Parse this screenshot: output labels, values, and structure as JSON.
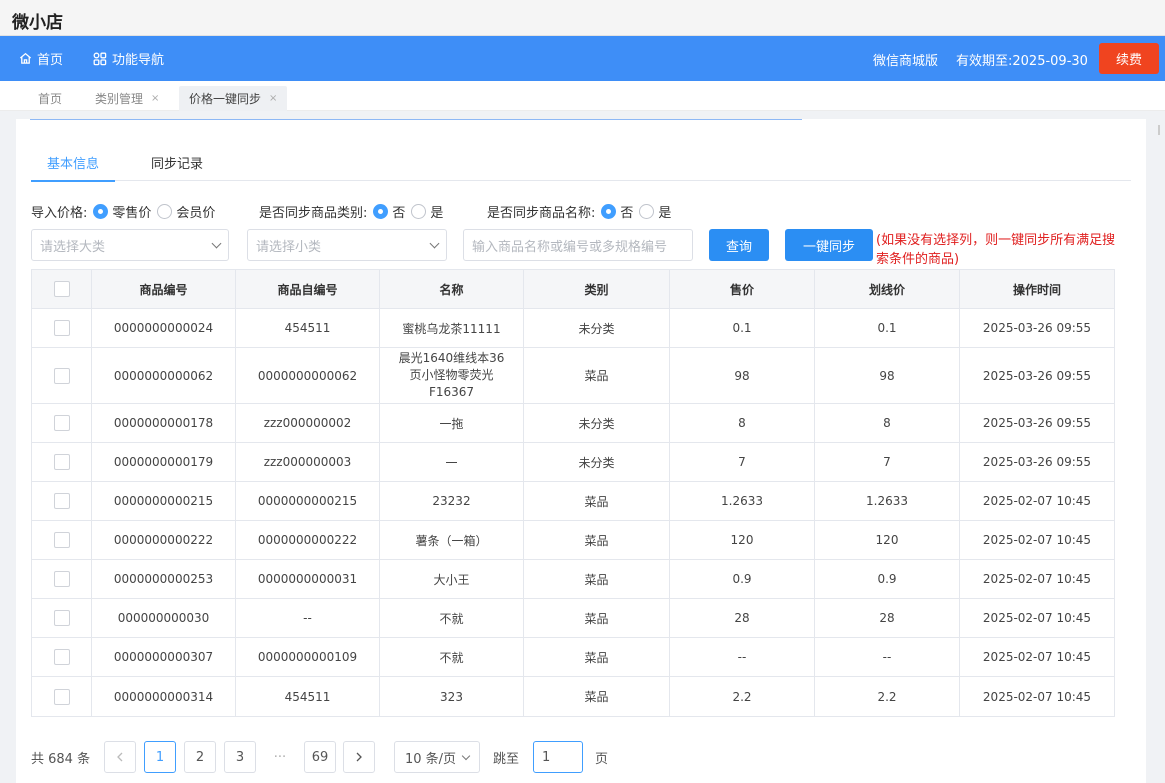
{
  "app": {
    "title": "微小店"
  },
  "nav": {
    "home": "首页",
    "functions": "功能导航",
    "edition": "微信商城版",
    "valid_until": "有效期至:2025-09-30",
    "renew": "续费"
  },
  "tabs": [
    {
      "label": "首页"
    },
    {
      "label": "类别管理"
    },
    {
      "label": "价格一键同步"
    }
  ],
  "subtabs": {
    "basic": "基本信息",
    "records": "同步记录"
  },
  "options": {
    "import_price_label": "导入价格:",
    "retail": "零售价",
    "member": "会员价",
    "sync_category_label": "是否同步商品类别:",
    "sync_name_label": "是否同步商品名称:",
    "no": "否",
    "yes": "是"
  },
  "filters": {
    "major_placeholder": "请选择大类",
    "minor_placeholder": "请选择小类",
    "search_placeholder": "输入商品名称或编号或多规格编号",
    "query": "查询",
    "sync": "一键同步",
    "note": "(如果没有选择列，则一键同步所有满足搜索条件的商品)"
  },
  "table": {
    "headers": [
      "商品编号",
      "商品自编号",
      "名称",
      "类别",
      "售价",
      "划线价",
      "操作时间"
    ],
    "rows": [
      [
        "0000000000024",
        "454511",
        "蜜桃乌龙茶11111",
        "未分类",
        "0.1",
        "0.1",
        "2025-03-26 09:55"
      ],
      [
        "0000000000062",
        "0000000000062",
        "晨光1640维线本36页小怪物零荧光F16367",
        "菜品",
        "98",
        "98",
        "2025-03-26 09:55"
      ],
      [
        "0000000000178",
        "zzz000000002",
        "一拖",
        "未分类",
        "8",
        "8",
        "2025-03-26 09:55"
      ],
      [
        "0000000000179",
        "zzz000000003",
        "一",
        "未分类",
        "7",
        "7",
        "2025-03-26 09:55"
      ],
      [
        "0000000000215",
        "0000000000215",
        "23232",
        "菜品",
        "1.2633",
        "1.2633",
        "2025-02-07 10:45"
      ],
      [
        "0000000000222",
        "0000000000222",
        "薯条（一箱）",
        "菜品",
        "120",
        "120",
        "2025-02-07 10:45"
      ],
      [
        "0000000000253",
        "0000000000031",
        "大小王",
        "菜品",
        "0.9",
        "0.9",
        "2025-02-07 10:45"
      ],
      [
        "000000000030",
        "--",
        "不就",
        "菜品",
        "28",
        "28",
        "2025-02-07 10:45"
      ],
      [
        "0000000000307",
        "0000000000109",
        "不就",
        "菜品",
        "--",
        "--",
        "2025-02-07 10:45"
      ],
      [
        "0000000000314",
        "454511",
        "323",
        "菜品",
        "2.2",
        "2.2",
        "2025-02-07 10:45"
      ]
    ]
  },
  "pagination": {
    "total": "共 684 条",
    "pages": [
      "1",
      "2",
      "3",
      "···",
      "69"
    ],
    "page_size": "10 条/页",
    "jump_label": "跳至",
    "jump_value": "1",
    "page_suffix": "页"
  },
  "icons": {
    "home": "home-icon",
    "functions": "grid-icon",
    "prev": "chevron-left-icon",
    "next": "chevron-right-icon"
  },
  "colors": {
    "nav": "#3e8ef7",
    "renew": "#f0441f",
    "primary": "#2b8ef3",
    "note": "#e02020"
  }
}
